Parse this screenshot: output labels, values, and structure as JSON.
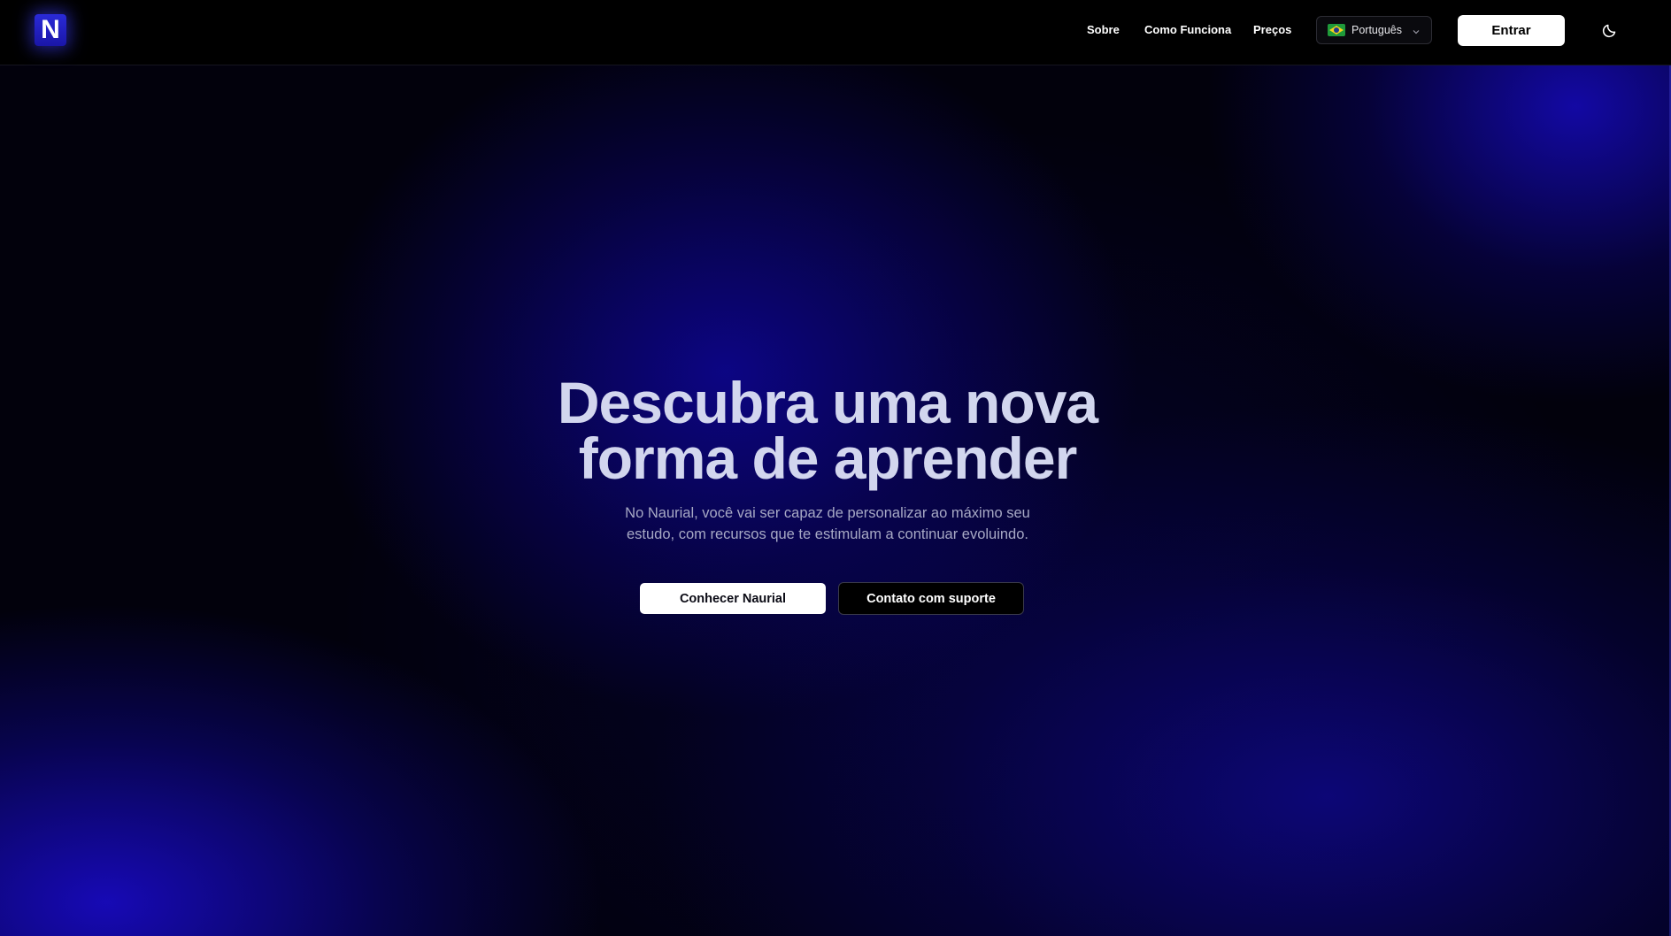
{
  "brand": {
    "logo_letter": "N"
  },
  "nav": {
    "links": [
      {
        "label": "Sobre"
      },
      {
        "label": "Como Funciona"
      },
      {
        "label": "Preços"
      }
    ],
    "language": {
      "selected": "Português",
      "flag_icon": "brazil-flag-icon"
    },
    "login_label": "Entrar",
    "theme_icon": "moon-icon"
  },
  "hero": {
    "title_line1": "Descubra uma nova",
    "title_line2": "forma de aprender",
    "subtitle_line1": "No Naurial, você vai ser capaz de personalizar ao máximo seu",
    "subtitle_line2": "estudo, com recursos que te estimulam a continuar evoluindo.",
    "primary_cta": "Conhecer Naurial",
    "secondary_cta": "Contato com suporte"
  },
  "colors": {
    "background": "#02010c",
    "accent_blue": "#1a16a8",
    "title": "#d2d6ee",
    "subtitle": "#a7a9c5"
  }
}
